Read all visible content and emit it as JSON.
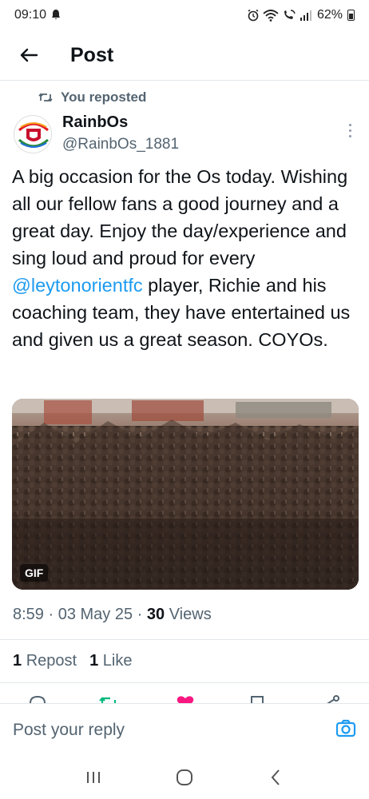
{
  "status_bar": {
    "time": "09:10",
    "battery": "62%"
  },
  "header": {
    "title": "Post"
  },
  "repost": {
    "label": "You reposted"
  },
  "author": {
    "name": "RainbOs",
    "handle": "@RainbOs_1881"
  },
  "tweet": {
    "text_before_mention": "A big occasion for the Os today. Wishing all our fellow fans a good journey and a great day. Enjoy the day/experience and sing loud and proud for every ",
    "mention": "@leytonorientfc",
    "text_after_mention": " player, Richie and his coaching team, they have entertained us and given us a great season. COYOs.",
    "media_badge": "GIF"
  },
  "meta": {
    "time": "8:59",
    "date": "03 May 25",
    "views_count": "30",
    "views_label": "Views"
  },
  "stats": {
    "reposts_count": "1",
    "reposts_label": "Repost",
    "likes_count": "1",
    "likes_label": "Like"
  },
  "reply": {
    "placeholder": "Post your reply"
  },
  "colors": {
    "accent": "#1d9bf0",
    "secondary_text": "#536471",
    "primary_text": "#0f1419",
    "repost_green": "#00ba7c",
    "like_pink": "#f91880"
  }
}
